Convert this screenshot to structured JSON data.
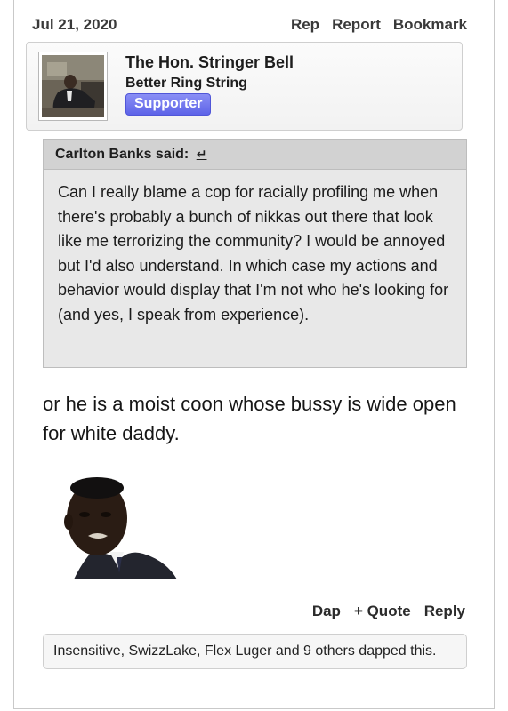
{
  "post": {
    "date": "Jul 21, 2020",
    "top_actions": [
      "Rep",
      "Report",
      "Bookmark"
    ]
  },
  "author": {
    "name": "The Hon. Stringer Bell",
    "title": "Better Ring String",
    "badge": "Supporter"
  },
  "quote": {
    "attribution": "Carlton Banks said:",
    "jump_icon": "↵",
    "text": "Can I really blame a cop for racially profiling me when there's probably a bunch of nikkas out there that look like me terrorizing the community? I would be annoyed but I'd also understand. In which case my actions and behavior would display that I'm not who he's looking for (and yes, I speak from experience)."
  },
  "message": {
    "text": "or he is a moist coon whose bussy is wide open for white daddy."
  },
  "actions": [
    "Dap",
    "+ Quote",
    "Reply"
  ],
  "likes": {
    "text": "Insensitive, SwizzLake, Flex Luger and 9 others dapped this."
  },
  "colors": {
    "badge": "#6c72ee",
    "quote_bg": "#e8e8e8",
    "quote_head_bg": "#d2d2d2"
  }
}
